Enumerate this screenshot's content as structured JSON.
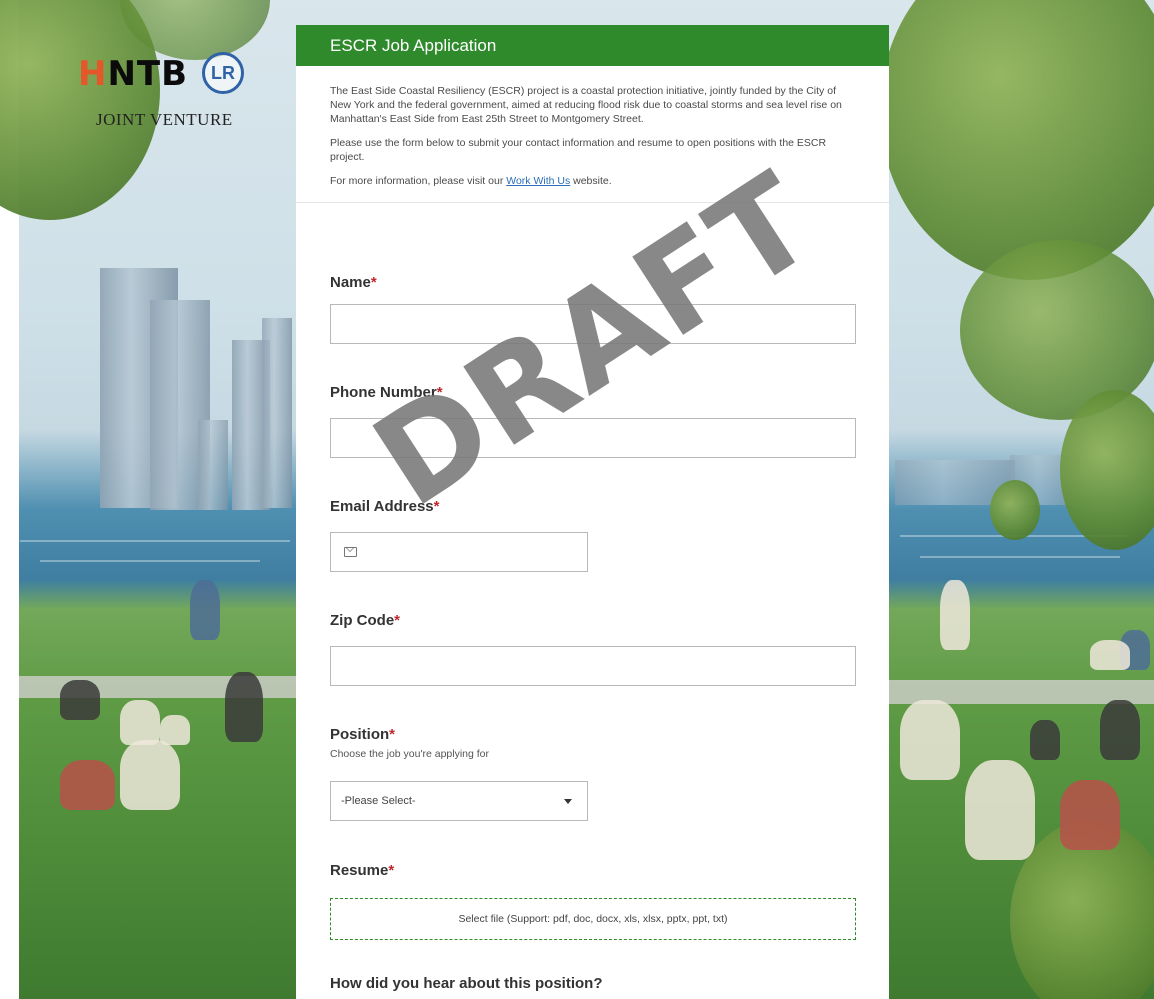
{
  "logo": {
    "wordmark_part1": "H",
    "wordmark_part2": "NTB",
    "seal_text": "LR",
    "subtitle": "JOINT VENTURE"
  },
  "form": {
    "title": "ESCR Job Application",
    "intro": {
      "paragraph1": "The East Side Coastal Resiliency (ESCR) project is a coastal protection initiative, jointly funded by the City of New York and the federal government, aimed at reducing flood risk due to coastal storms and sea level rise on Manhattan's East Side from East 25th Street to Montgomery Street.",
      "paragraph2": "Please use the form below to submit your contact information and resume to open positions with the ESCR project.",
      "paragraph3_before": "For more information, please visit our ",
      "paragraph3_link": "Work With Us",
      "paragraph3_after": " website."
    },
    "required_marker": "*",
    "questions": {
      "name": {
        "label": "Name",
        "value": ""
      },
      "phone": {
        "label": "Phone Number",
        "value": ""
      },
      "email": {
        "label": "Email Address",
        "value": "",
        "icon": "mail-icon"
      },
      "zip": {
        "label": "Zip Code",
        "value": ""
      },
      "position": {
        "label": "Position",
        "hint": "Choose the job you're applying for",
        "selected": "-Please Select-"
      },
      "resume": {
        "label": "Resume",
        "dropzone_text": "Select file (Support: pdf, doc, docx, xls, xlsx, pptx, ppt, txt)"
      },
      "source": {
        "label": "How did you hear about this position?"
      }
    }
  },
  "watermark": "DRAFT",
  "colors": {
    "header_green": "#2f8a2b",
    "required_red": "#c0272d",
    "link_blue": "#2d6db5",
    "logo_accent": "#e3572b",
    "seal_blue": "#2f62a6"
  }
}
